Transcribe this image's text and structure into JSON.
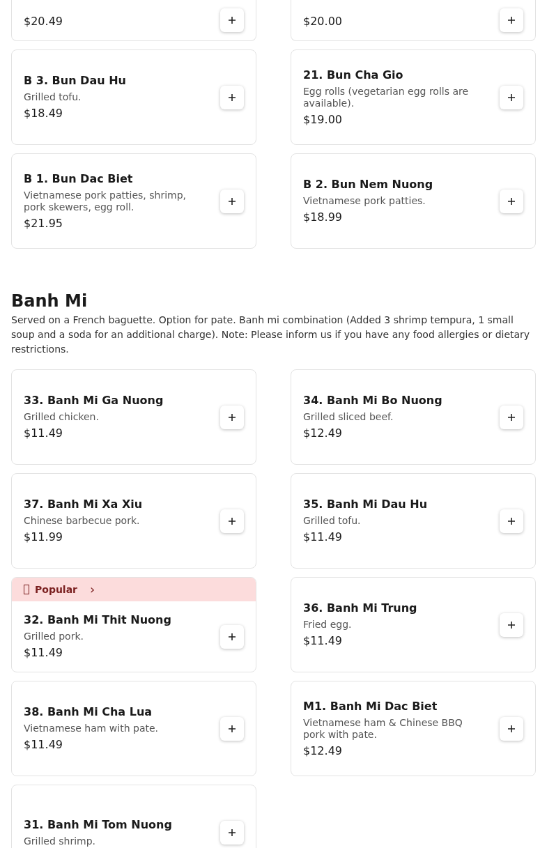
{
  "upper_section": {
    "items": [
      {
        "price": "$20.49"
      },
      {
        "price": "$20.00"
      },
      {
        "name": "B 3. Bun Dau Hu",
        "description": "Grilled tofu.",
        "price": "$18.49"
      },
      {
        "name": "21. Bun Cha Gio",
        "description": "Egg rolls (vegetarian egg rolls are available).",
        "price": "$19.00"
      },
      {
        "name": "B 1. Bun Dac Biet",
        "description": "Vietnamese pork patties, shrimp, pork skewers, egg roll.",
        "price": "$21.95"
      },
      {
        "name": "B 2. Bun Nem Nuong",
        "description": "Vietnamese pork patties.",
        "price": "$18.99"
      }
    ]
  },
  "section": {
    "title": "Banh Mi",
    "description": "Served on a French baguette. Option for pate. Banh mi combination (Added 3 shrimp tempura, 1 small soup and a soda for an additional charge). Note: Please inform us if you have any food allergies or dietary restrictions.",
    "items": [
      {
        "name": "33. Banh Mi Ga Nuong",
        "description": "Grilled chicken.",
        "price": "$11.49"
      },
      {
        "name": "34. Banh Mi Bo Nuong",
        "description": "Grilled sliced beef.",
        "price": "$12.49"
      },
      {
        "name": "37. Banh Mi Xa Xiu",
        "description": "Chinese barbecue pork.",
        "price": "$11.99"
      },
      {
        "name": "35. Banh Mi Dau Hu",
        "description": "Grilled tofu.",
        "price": "$11.49"
      },
      {
        "name": "32. Banh Mi Thit Nuong",
        "description": "Grilled pork.",
        "price": "$11.49",
        "badge": {
          "label": "Popular",
          "chevron": "›"
        }
      },
      {
        "name": "36. Banh Mi Trung",
        "description": "Fried egg.",
        "price": "$11.49"
      },
      {
        "name": "38. Banh Mi Cha Lua",
        "description": "Vietnamese ham with pate.",
        "price": "$11.49"
      },
      {
        "name": "M1. Banh Mi Dac Biet",
        "description": "Vietnamese ham & Chinese BBQ pork with pate.",
        "price": "$12.49"
      },
      {
        "name": "31. Banh Mi Tom Nuong",
        "description": "Grilled shrimp."
      }
    ]
  }
}
